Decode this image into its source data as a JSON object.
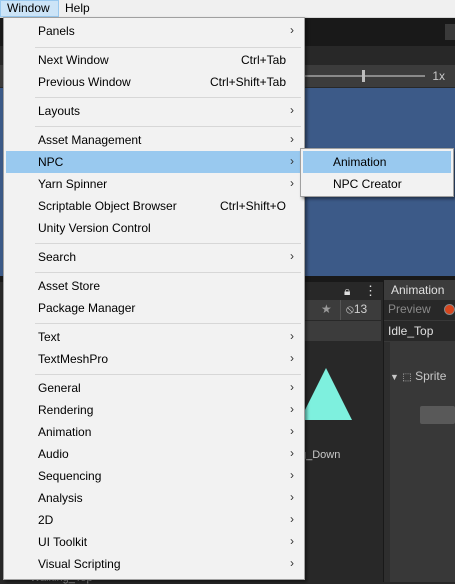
{
  "menubar": {
    "items": [
      {
        "label": "Window",
        "active": true
      },
      {
        "label": "Help",
        "active": false
      }
    ]
  },
  "window_menu": {
    "items": [
      {
        "label": "Panels",
        "shortcut": "",
        "submenu": true
      },
      {
        "label": "Next Window",
        "shortcut": "Ctrl+Tab",
        "submenu": false
      },
      {
        "label": "Previous Window",
        "shortcut": "Ctrl+Shift+Tab",
        "submenu": false
      },
      {
        "label": "Layouts",
        "shortcut": "",
        "submenu": true
      },
      {
        "label": "Asset Management",
        "shortcut": "",
        "submenu": true
      },
      {
        "label": "NPC",
        "shortcut": "",
        "submenu": true,
        "highlighted": true
      },
      {
        "label": "Yarn Spinner",
        "shortcut": "",
        "submenu": true
      },
      {
        "label": "Scriptable Object Browser",
        "shortcut": "Ctrl+Shift+O",
        "submenu": false
      },
      {
        "label": "Unity Version Control",
        "shortcut": "",
        "submenu": false
      },
      {
        "label": "Search",
        "shortcut": "",
        "submenu": true
      },
      {
        "label": "Asset Store",
        "shortcut": "",
        "submenu": false
      },
      {
        "label": "Package Manager",
        "shortcut": "",
        "submenu": false
      },
      {
        "label": "Text",
        "shortcut": "",
        "submenu": true
      },
      {
        "label": "TextMeshPro",
        "shortcut": "",
        "submenu": true
      },
      {
        "label": "General",
        "shortcut": "",
        "submenu": true
      },
      {
        "label": "Rendering",
        "shortcut": "",
        "submenu": true
      },
      {
        "label": "Animation",
        "shortcut": "",
        "submenu": true
      },
      {
        "label": "Audio",
        "shortcut": "",
        "submenu": true
      },
      {
        "label": "Sequencing",
        "shortcut": "",
        "submenu": true
      },
      {
        "label": "Analysis",
        "shortcut": "",
        "submenu": true
      },
      {
        "label": "2D",
        "shortcut": "",
        "submenu": true
      },
      {
        "label": "UI Toolkit",
        "shortcut": "",
        "submenu": true
      },
      {
        "label": "Visual Scripting",
        "shortcut": "",
        "submenu": true
      }
    ]
  },
  "npc_submenu": {
    "items": [
      {
        "label": "Animation",
        "highlighted": true
      },
      {
        "label": "NPC Creator",
        "highlighted": false
      }
    ]
  },
  "background": {
    "zoom": "1x",
    "hidden_count": "13",
    "animation_tab": "Animation",
    "preview_label": "Preview",
    "clip_name": "Idle_Top",
    "sprite_property": "Sprite",
    "thumb_label": "g_Down",
    "bottom_label": "Walking_Top"
  },
  "icons": {
    "submenu_arrow": "chevron-right-icon",
    "lock": "lock-icon",
    "kebab": "kebab-menu-icon",
    "star": "star-icon",
    "eye_hidden": "eye-slash-icon",
    "record": "record-icon"
  },
  "colors": {
    "menu_bg": "#f2f2f2",
    "menu_highlight": "#99c9ef",
    "menubar_active": "#cce4f7",
    "scene_bg": "#3c5a88",
    "sprite_color": "#7ef0de",
    "record": "#d6461e"
  }
}
